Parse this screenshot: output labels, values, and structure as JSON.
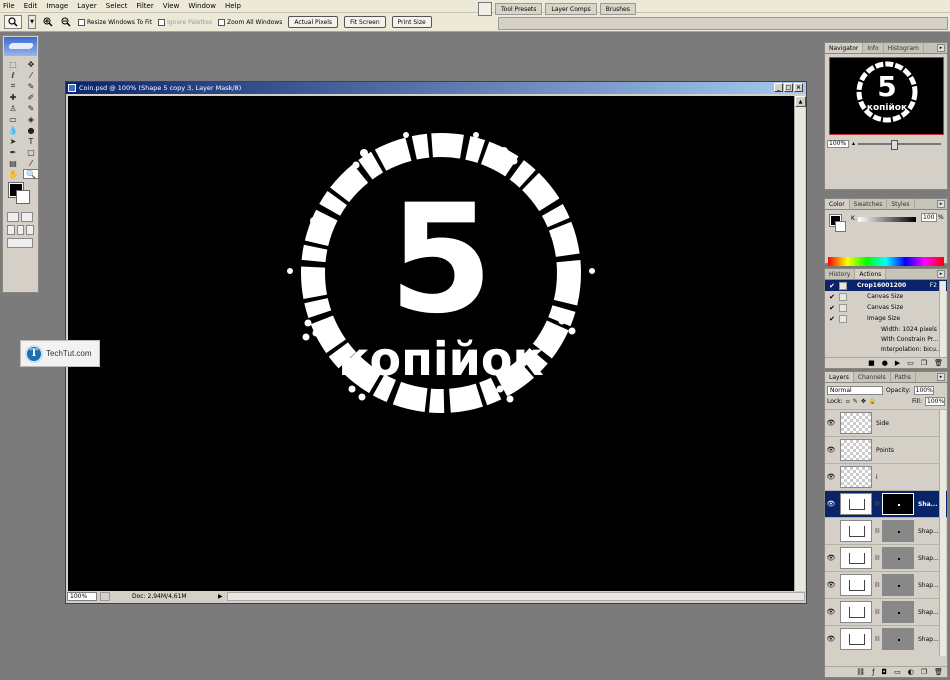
{
  "menu": [
    "File",
    "Edit",
    "Image",
    "Layer",
    "Select",
    "Filter",
    "View",
    "Window",
    "Help"
  ],
  "options_bar": {
    "resize_windows": "Resize Windows To Fit",
    "ignore_palettes": "Ignore Palettes",
    "zoom_all": "Zoom All Windows",
    "actual_pixels": "Actual Pixels",
    "fit_screen": "Fit Screen",
    "print_size": "Print Size"
  },
  "palette_well": [
    "Tool Presets",
    "Layer Comps",
    "Brushes"
  ],
  "document": {
    "title": "Coin.psd @ 100% (Shape 5 copy 3, Layer Mask/8)",
    "zoom": "100%",
    "doc_size": "Doc: 2,94M/4,61M"
  },
  "coin": {
    "numeral": "5",
    "word": "копійок"
  },
  "watermark": {
    "letter": "T",
    "text": "TechTut.com"
  },
  "navigator": {
    "tabs": [
      "Navigator",
      "Info",
      "Histogram"
    ],
    "zoom": "100%"
  },
  "color": {
    "tabs": [
      "Color",
      "Swatches",
      "Styles"
    ],
    "channel": "K",
    "value": "100",
    "unit": "%"
  },
  "history": {
    "tabs": [
      "History",
      "Actions"
    ],
    "items": [
      "Crop16001200",
      "Canvas Size",
      "Canvas Size",
      "Image Size",
      "Width: 1024 pixels",
      "With Constrain Pr...",
      "Interpolation: bicu..."
    ],
    "shortcut": "F2"
  },
  "layers": {
    "tabs": [
      "Layers",
      "Channels",
      "Paths"
    ],
    "blend": "Normal",
    "opacity_label": "Opacity:",
    "opacity": "100%",
    "lock_label": "Lock:",
    "fill_label": "Fill:",
    "fill": "100%",
    "items": [
      "Side",
      "Points",
      "i",
      "Sha...",
      "Shap...",
      "Shap...",
      "Shap...",
      "Shap...",
      "Shap..."
    ]
  }
}
